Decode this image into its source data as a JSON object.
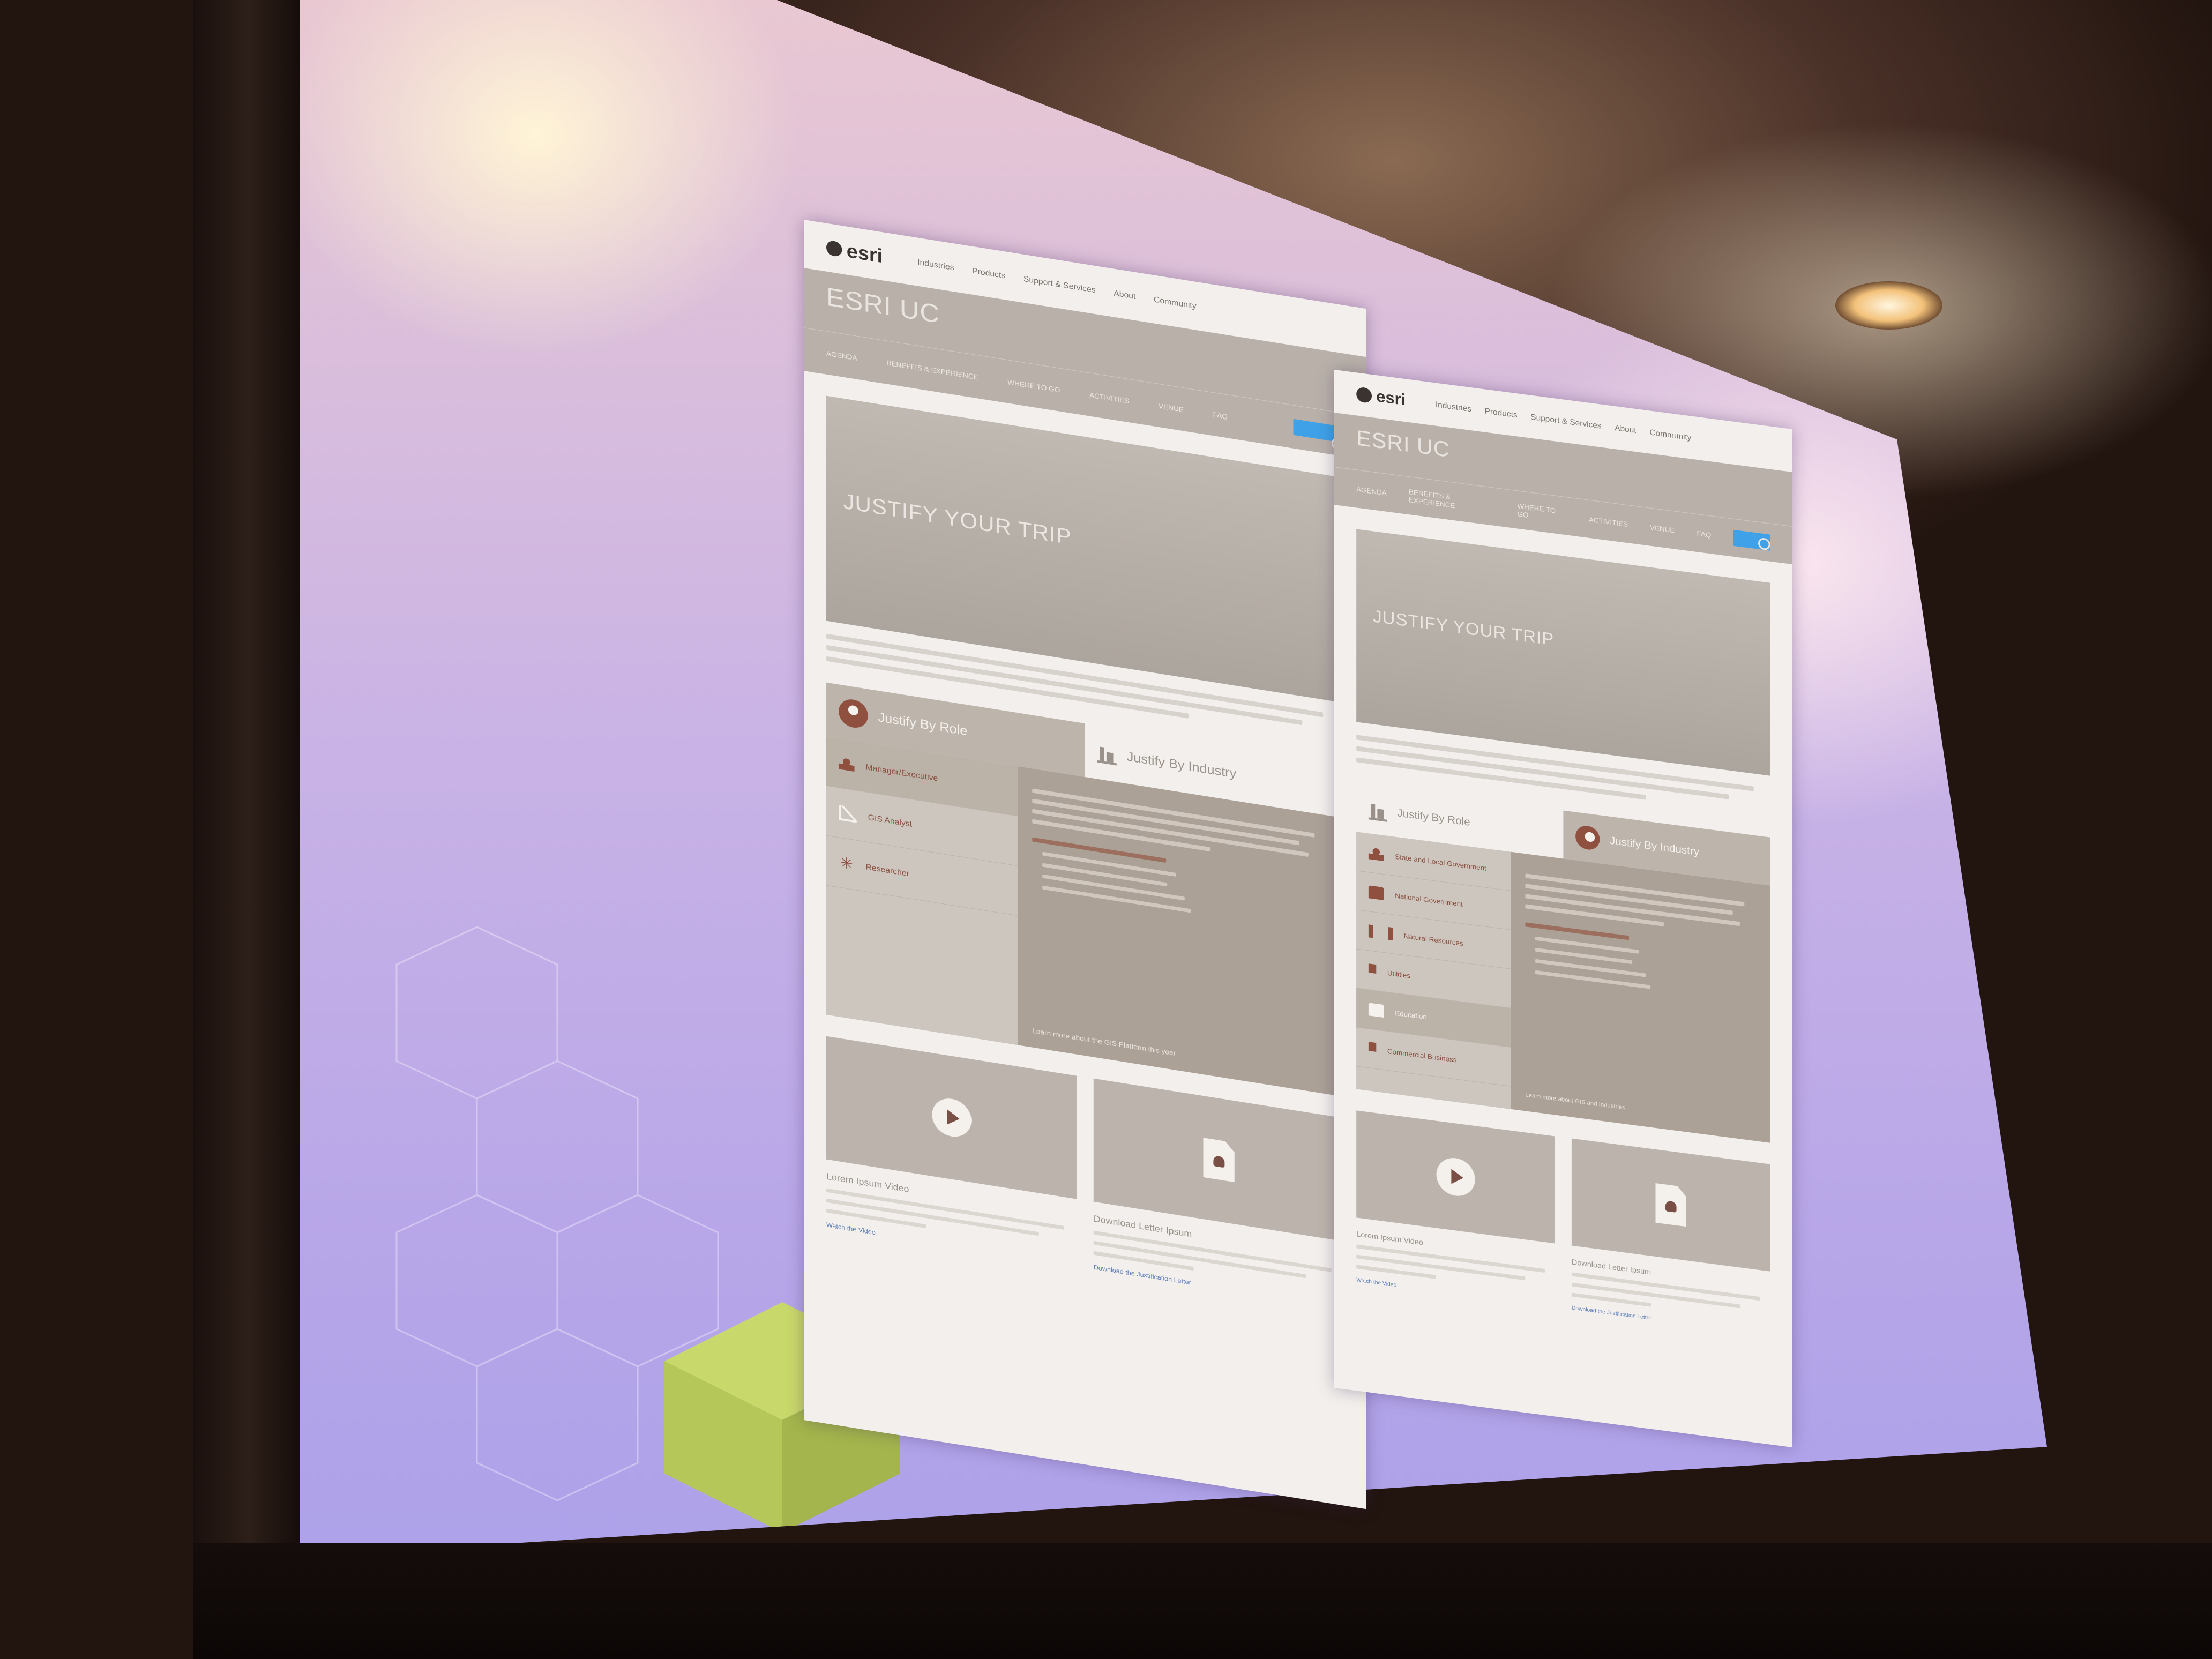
{
  "mockup_left": {
    "logo": "esri",
    "top_nav": [
      "Industries",
      "Products",
      "Support & Services",
      "About",
      "Community"
    ],
    "banner_title": "ESRI UC",
    "banner_subtitle": "",
    "sub_nav": [
      "AGENDA",
      "BENEFITS & EXPERIENCE",
      "WHERE TO GO",
      "ACTIVITIES",
      "VENUE",
      "FAQ"
    ],
    "hero_title": "JUSTIFY YOUR TRIP",
    "tab_role": "Justify By Role",
    "tab_industry": "Justify By Industry",
    "roles": [
      "Manager/Executive",
      "GIS Analyst",
      "Researcher"
    ],
    "detail_link": "Learn more about the GIS Platform this year",
    "tile_video_title": "Lorem Ipsum Video",
    "tile_video_link": "Watch the Video",
    "tile_doc_title": "Download Letter Ipsum",
    "tile_doc_link": "Download the Justification Letter"
  },
  "mockup_right": {
    "logo": "esri",
    "top_nav": [
      "Industries",
      "Products",
      "Support & Services",
      "About",
      "Community"
    ],
    "banner_title": "ESRI UC",
    "banner_subtitle": "",
    "sub_nav": [
      "AGENDA",
      "BENEFITS & EXPERIENCE",
      "WHERE TO GO",
      "ACTIVITIES",
      "VENUE",
      "FAQ"
    ],
    "hero_title": "JUSTIFY YOUR TRIP",
    "tab_role": "Justify By Role",
    "tab_industry": "Justify By Industry",
    "industries": [
      "State and Local Government",
      "National Government",
      "Natural Resources",
      "Utilities",
      "Education",
      "Commercial Business"
    ],
    "detail_link": "Learn more about GIS and Industries",
    "tile_video_title": "Lorem Ipsum Video",
    "tile_video_link": "Watch the Video",
    "tile_doc_title": "Download Letter Ipsum",
    "tile_doc_link": "Download the Justification Letter"
  },
  "colors": {
    "accent_blue": "#3fa1e8",
    "rust": "#8f5040",
    "screen_lavender": "#b7a6e8",
    "cube_green": "#b6c75a"
  }
}
